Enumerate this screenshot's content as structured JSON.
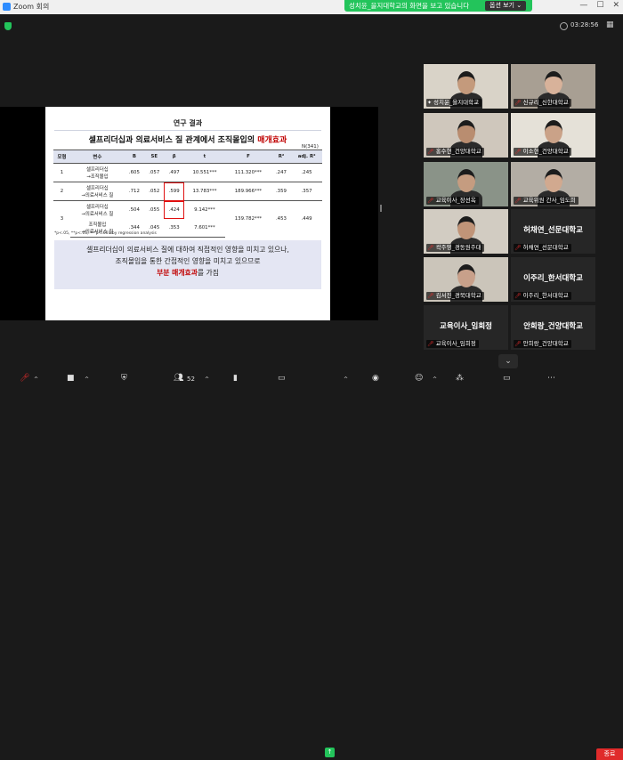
{
  "window": {
    "title": "Zoom 회의"
  },
  "share_bar": {
    "text": "성치윤_을지대학교의 화면을 보고 있습니다",
    "options_label": "옵션 보기 ⌄"
  },
  "meeting": {
    "timer": "03:28:56"
  },
  "slide": {
    "section_title": "연구 결과",
    "heading_main": "셀프리더십과 의료서비스 질 관계에서 조직몰입의 ",
    "heading_red": "매개효과",
    "n": "N(341)",
    "table": {
      "headers": [
        "모형",
        "변수",
        "B",
        "SE",
        "β",
        "t",
        "F",
        "R²",
        "adj. R²"
      ],
      "rows": [
        {
          "model": "1",
          "var1": "셀프리더십",
          "var2": "→조직몰입",
          "B": ".605",
          "SE": ".057",
          "beta": ".497",
          "t": "10.551***",
          "F": "111.320***",
          "R2": ".247",
          "adjR2": ".245"
        },
        {
          "model": "2",
          "var1": "셀프리더십",
          "var2": "→의료서비스 질",
          "B": ".712",
          "SE": ".052",
          "beta": ".599",
          "t": "13.783***",
          "F": "189.966***",
          "R2": ".359",
          "adjR2": ".357"
        },
        {
          "model": "3",
          "var1": "셀프리더십",
          "var2": "→의료서비스 질",
          "B": ".504",
          "SE": ".055",
          "beta": ".424",
          "t": "9.142***",
          "F": "139.782***",
          "R2": ".453",
          "adjR2": ".449"
        },
        {
          "model": "",
          "var1": "조직몰입",
          "var2": "→의료서비스 질",
          "B": ".344",
          "SE": ".045",
          "beta": ".353",
          "t": "7.601***",
          "F": "",
          "R2": "",
          "adjR2": ""
        }
      ]
    },
    "footnote": "*p<.05, **p<.01, ***p<.001 by regression analysis",
    "summary_line1": "셀프리더십이 의료서비스 질에 대하여 직접적인 영향을 미치고 있으나,",
    "summary_line2": "조직몰입을 통한 간접적인 영향을 미치고 있으므로",
    "summary_red": "부분 매개효과",
    "summary_tail": "를 가짐"
  },
  "participants": [
    {
      "name": "성치윤_을지대학교",
      "big": "",
      "video": true,
      "active": true,
      "mic_off": false
    },
    {
      "name": "신규리_신한대학교",
      "big": "",
      "video": true,
      "active": false,
      "mic_off": true
    },
    {
      "name": "홍수현_건양대학교",
      "big": "",
      "video": true,
      "active": false,
      "mic_off": true
    },
    {
      "name": "이소현_건양대학교",
      "big": "",
      "video": true,
      "active": false,
      "mic_off": true
    },
    {
      "name": "교육이사_장선옥",
      "big": "",
      "video": true,
      "active": false,
      "mic_off": true
    },
    {
      "name": "교육위원 간사_임도희",
      "big": "",
      "video": true,
      "active": false,
      "mic_off": true
    },
    {
      "name": "곽주영_경동원주대",
      "big": "",
      "video": true,
      "active": false,
      "mic_off": true
    },
    {
      "name": "허채연_선문대학교",
      "big": "허채연_선문대학교",
      "video": false,
      "active": false,
      "mic_off": true
    },
    {
      "name": "김서진_경북대학교",
      "big": "",
      "video": true,
      "active": false,
      "mic_off": true
    },
    {
      "name": "이주리_한서대학교",
      "big": "이주리_한서대학교",
      "video": false,
      "active": false,
      "mic_off": true
    },
    {
      "name": "교육이사_임희정",
      "big": "교육이사_임희정",
      "video": false,
      "active": false,
      "mic_off": true
    },
    {
      "name": "안희랑_건양대학교",
      "big": "안희랑_건양대학교",
      "video": false,
      "active": false,
      "mic_off": true
    }
  ],
  "toolbar": {
    "participants_count": "52",
    "end_label": "종료"
  },
  "colors": {
    "share_green": "#23c45b",
    "active_border": "#b7e000",
    "accent_red": "#c00000",
    "end_red": "#e02b2b"
  }
}
